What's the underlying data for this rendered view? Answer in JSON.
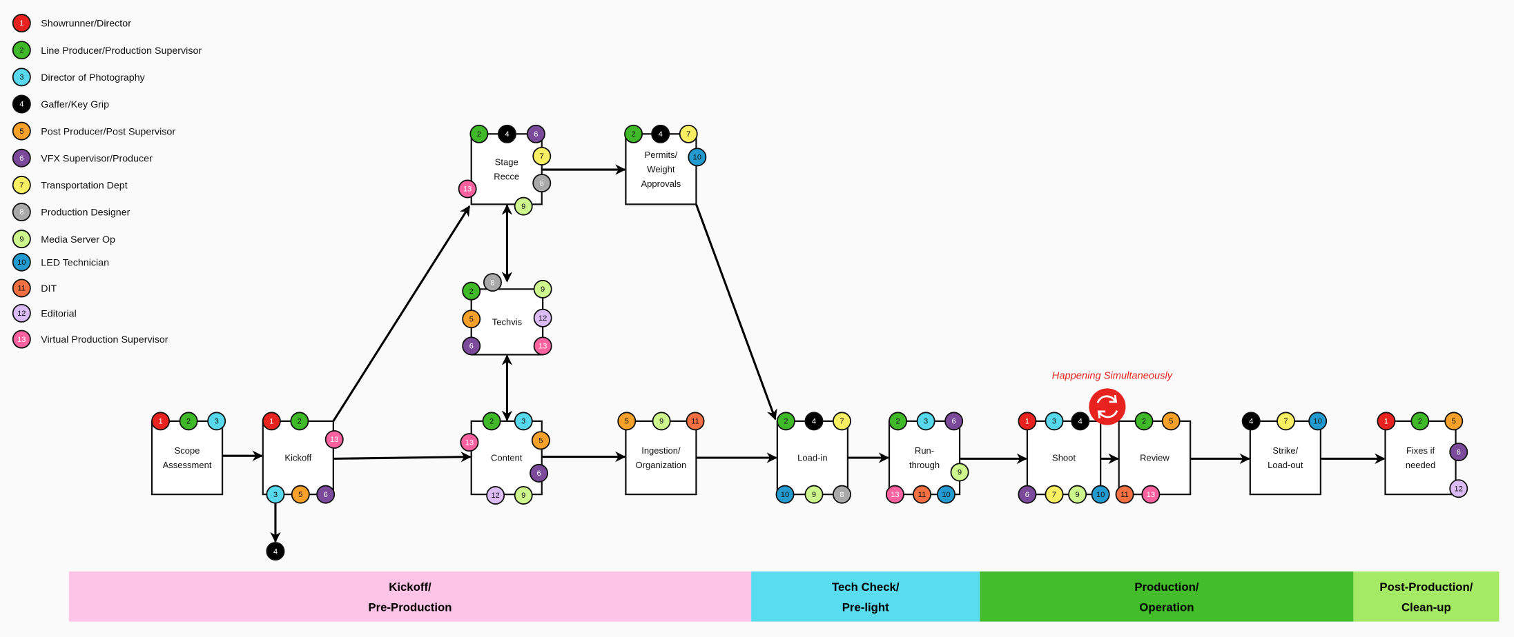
{
  "roles": [
    {
      "num": "1",
      "label": "Showrunner/Director",
      "color": "#e8221f",
      "text_color": "#ffffff"
    },
    {
      "num": "2",
      "label": "Line Producer/Production Supervisor",
      "color": "#3fb928",
      "text_color": "#111111"
    },
    {
      "num": "3",
      "label": "Director of Photography",
      "color": "#58d8ec",
      "text_color": "#111111"
    },
    {
      "num": "4",
      "label": "Gaffer/Key Grip",
      "color": "#000000",
      "text_color": "#ffffff"
    },
    {
      "num": "5",
      "label": "Post Producer/Post Supervisor",
      "color": "#f7a12b",
      "text_color": "#111111"
    },
    {
      "num": "6",
      "label": "VFX Supervisor/Producer",
      "color": "#7b4a9b",
      "text_color": "#ffffff"
    },
    {
      "num": "7",
      "label": "Transportation Dept",
      "color": "#f8ef63",
      "text_color": "#111111"
    },
    {
      "num": "8",
      "label": "Production Designer",
      "color": "#a9a9a9",
      "text_color": "#ffffff"
    },
    {
      "num": "9",
      "label": "Media Server Op",
      "color": "#cdf68c",
      "text_color": "#111111"
    },
    {
      "num": "10",
      "label": "LED Technician",
      "color": "#239bd0",
      "text_color": "#111111"
    },
    {
      "num": "11",
      "label": "DIT",
      "color": "#f27041",
      "text_color": "#111111"
    },
    {
      "num": "12",
      "label": "Editorial",
      "color": "#dcbcf6",
      "text_color": "#111111"
    },
    {
      "num": "13",
      "label": "Virtual Production Supervisor",
      "color": "#f9619f",
      "text_color": "#ffffff"
    }
  ],
  "nodes": [
    {
      "id": "scope",
      "lines": [
        "Scope",
        "Assessment"
      ],
      "roles": [
        "1",
        "2",
        "3"
      ]
    },
    {
      "id": "kickoff",
      "lines": [
        "Kickoff"
      ],
      "roles": [
        "1",
        "2",
        "13",
        "3",
        "5",
        "6",
        "4"
      ]
    },
    {
      "id": "stage",
      "lines": [
        "Stage",
        "Recce"
      ],
      "roles": [
        "2",
        "4",
        "6",
        "7",
        "8",
        "9",
        "13"
      ]
    },
    {
      "id": "permits",
      "lines": [
        "Permits/",
        "Weight",
        "Approvals"
      ],
      "roles": [
        "2",
        "4",
        "7",
        "10"
      ]
    },
    {
      "id": "techvis",
      "lines": [
        "Techvis"
      ],
      "roles": [
        "8",
        "2",
        "9",
        "5",
        "12",
        "6",
        "13"
      ]
    },
    {
      "id": "content",
      "lines": [
        "Content"
      ],
      "roles": [
        "2",
        "3",
        "13",
        "5",
        "6",
        "12",
        "9"
      ]
    },
    {
      "id": "ingestion",
      "lines": [
        "Ingestion/",
        "Organization"
      ],
      "roles": [
        "5",
        "9",
        "11"
      ]
    },
    {
      "id": "loadin",
      "lines": [
        "Load-in"
      ],
      "roles": [
        "2",
        "4",
        "7",
        "10",
        "9",
        "8"
      ]
    },
    {
      "id": "run",
      "lines": [
        "Run-",
        "through"
      ],
      "roles": [
        "2",
        "3",
        "6",
        "9",
        "13",
        "11",
        "10"
      ]
    },
    {
      "id": "shoot",
      "lines": [
        "Shoot"
      ],
      "roles": [
        "1",
        "3",
        "4",
        "6",
        "7",
        "9",
        "10"
      ]
    },
    {
      "id": "review",
      "lines": [
        "Review"
      ],
      "roles": [
        "2",
        "5",
        "11",
        "13"
      ]
    },
    {
      "id": "strike",
      "lines": [
        "Strike/",
        "Load-out"
      ],
      "roles": [
        "4",
        "7",
        "10"
      ]
    },
    {
      "id": "fixes",
      "lines": [
        "Fixes if",
        "needed"
      ],
      "roles": [
        "1",
        "2",
        "5",
        "6",
        "12"
      ]
    }
  ],
  "simultaneous_note": "Happening Simultaneously",
  "sync_icon": "sync-arrows-icon",
  "sync_color": "#e8221f",
  "phases": [
    {
      "lines": [
        "Kickoff/",
        "Pre-Production"
      ],
      "color": "#fdc4e6"
    },
    {
      "lines": [
        "Tech Check/",
        "Pre-light"
      ],
      "color": "#5adcef"
    },
    {
      "lines": [
        "Production/",
        "Operation"
      ],
      "color": "#43bd2a"
    },
    {
      "lines": [
        "Post-Production/",
        "Clean-up"
      ],
      "color": "#a5ea65"
    }
  ]
}
